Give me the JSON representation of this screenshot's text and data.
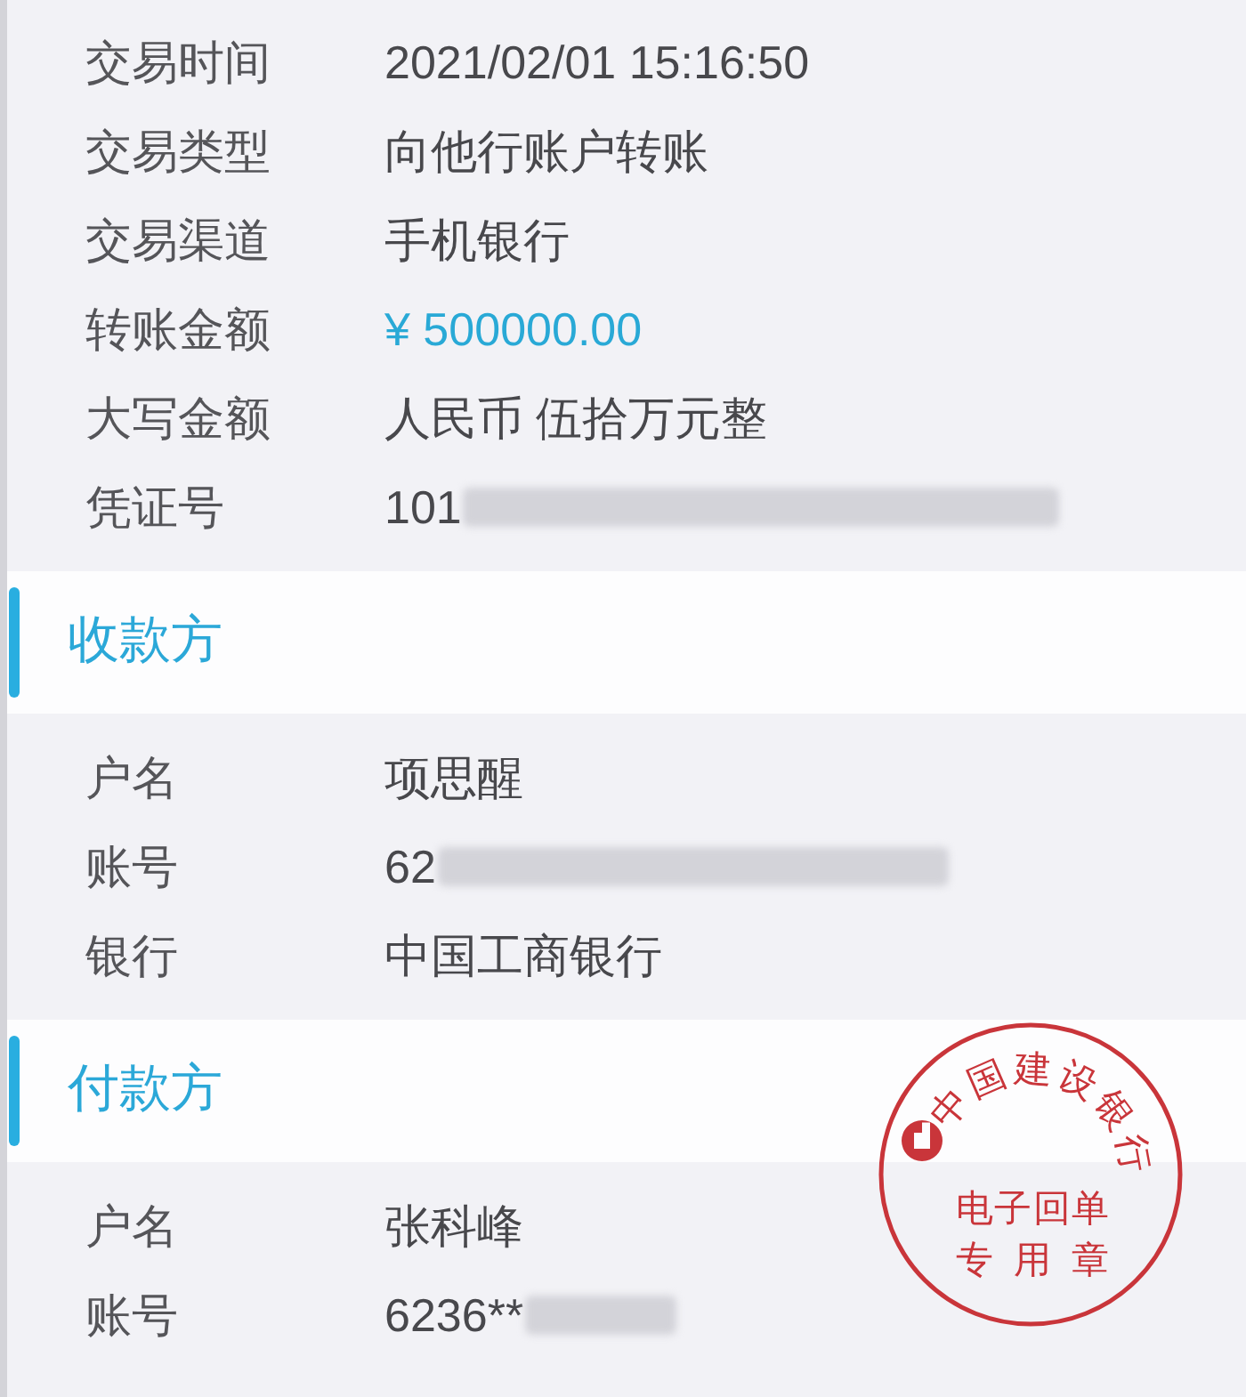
{
  "details": {
    "rows": [
      {
        "label": "交易时间",
        "value": "2021/02/01 15:16:50",
        "kind": "plain"
      },
      {
        "label": "交易类型",
        "value": "向他行账户转账",
        "kind": "plain"
      },
      {
        "label": "交易渠道",
        "value": "手机银行",
        "kind": "plain"
      },
      {
        "label": "转账金额",
        "value": "¥ 500000.00",
        "kind": "amount"
      },
      {
        "label": "大写金额",
        "value": "人民币 伍拾万元整",
        "kind": "plain"
      },
      {
        "label": "凭证号",
        "value": "101",
        "kind": "masked"
      }
    ]
  },
  "sections": [
    {
      "title": "收款方",
      "rows": [
        {
          "label": "户名",
          "value": "项思醒",
          "kind": "plain"
        },
        {
          "label": "账号",
          "value": "62",
          "kind": "masked"
        },
        {
          "label": "银行",
          "value": "中国工商银行",
          "kind": "plain"
        }
      ]
    },
    {
      "title": "付款方",
      "rows": [
        {
          "label": "户名",
          "value": "张科峰",
          "kind": "plain"
        },
        {
          "label": "账号",
          "value": "6236**",
          "kind": "masked"
        }
      ]
    }
  ],
  "stamp": {
    "arc_text": "中国建设银行",
    "lines": [
      "电子回单",
      "专用章"
    ]
  }
}
